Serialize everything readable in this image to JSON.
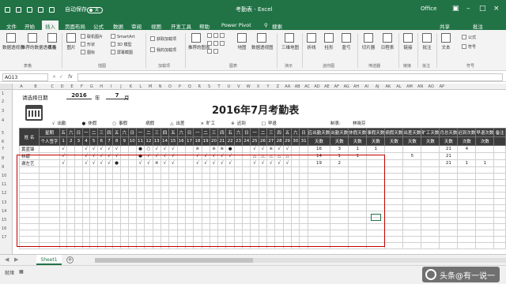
{
  "titlebar": {
    "autosave": "自动保存",
    "autosave_state": "关",
    "doc_title": "考勤表 - Excel",
    "account": "Office",
    "share": "共享",
    "comment": "批注"
  },
  "menu": {
    "tabs": [
      "文件",
      "开始",
      "插入",
      "页面布局",
      "公式",
      "数据",
      "审阅",
      "视图",
      "开发工具",
      "帮助",
      "Power Pivot",
      "搜索"
    ],
    "active": "插入"
  },
  "ribbon": {
    "btn": {
      "pivot": "数据透视表",
      "rec_pivot": "推荐的数据透视表",
      "table": "表格",
      "picture": "图片",
      "online_pic": "联机图片",
      "shapes": "形状",
      "icons": "图标",
      "smartart": "SmartArt",
      "model3d": "3D 模型",
      "screenshot": "屏幕截图",
      "get_addins": "获取加载项",
      "my_addins": "我的加载项",
      "rec_chart": "推荐的图表",
      "map": "地图",
      "pivot_chart": "数据透视图",
      "map3d": "三维地图",
      "line": "折线",
      "column": "柱形",
      "winloss": "盈亏",
      "slicer": "切片器",
      "timeline": "日程表",
      "link": "链接",
      "comment": "批注",
      "text": "文本",
      "formula": "公式",
      "symbol": "符号"
    },
    "groups": {
      "tables": "表格",
      "illustrations": "插图",
      "addins": "加载项",
      "charts": "图表",
      "tours": "演示",
      "sparklines": "迷你图",
      "filters": "筛选器",
      "links": "链接",
      "comments": "批注",
      "symbols": "符号"
    }
  },
  "formula": {
    "name_box": "AG13",
    "fx": "fx"
  },
  "columns": [
    "A",
    "B",
    "C",
    "D",
    "E",
    "F",
    "G",
    "H",
    "I",
    "J",
    "K",
    "L",
    "M",
    "N",
    "O",
    "P",
    "Q",
    "R",
    "S",
    "T",
    "U",
    "V",
    "W",
    "X",
    "Y",
    "Z",
    "AA",
    "AB",
    "AC",
    "AD",
    "AE",
    "AF",
    "AG",
    "AH",
    "AI",
    "AJ",
    "AK",
    "AL",
    "AM",
    "AN",
    "AO",
    "AP"
  ],
  "rows": [
    "1",
    "2",
    "3",
    "4",
    "5",
    "6",
    "7",
    "8",
    "9",
    "10",
    "11",
    "12",
    "13",
    "14",
    "15",
    "16",
    "17"
  ],
  "sheet": {
    "select_date": "请选择日期",
    "year": "2016",
    "year_unit": "年",
    "month": "7",
    "month_unit": "月",
    "title": "2016年7月考勤表",
    "legend": [
      {
        "s": "√",
        "l": "出勤"
      },
      {
        "s": "●",
        "l": "休假"
      },
      {
        "s": "○",
        "l": "事假"
      },
      {
        "s": "",
        "l": "病假"
      },
      {
        "s": "△",
        "l": "出差"
      },
      {
        "s": "×",
        "l": "旷工"
      },
      {
        "s": "※",
        "l": "迟到"
      },
      {
        "s": "□",
        "l": "早退"
      }
    ],
    "maker_label": "制表:",
    "maker": "林晓芬",
    "name_header": "姓 名",
    "week_label": "星期",
    "sign_label": "个人签字",
    "weekdays": [
      "五",
      "六",
      "日",
      "一",
      "二",
      "三",
      "四",
      "五",
      "六",
      "日",
      "一",
      "二",
      "三",
      "四",
      "五",
      "六",
      "日",
      "一",
      "二",
      "三",
      "四",
      "五",
      "六",
      "日",
      "一",
      "二",
      "三",
      "四",
      "五",
      "六",
      "日"
    ],
    "days": [
      "1",
      "2",
      "3",
      "4",
      "5",
      "6",
      "7",
      "8",
      "9",
      "10",
      "11",
      "12",
      "13",
      "14",
      "15",
      "16",
      "17",
      "18",
      "19",
      "20",
      "21",
      "22",
      "23",
      "24",
      "25",
      "26",
      "27",
      "28",
      "29",
      "30",
      "31"
    ],
    "summary_top": [
      "应出勤天数",
      "出勤天数",
      "休假天数",
      "事假天数",
      "病假天数",
      "出差天数",
      "旷工天数",
      "月总天数",
      "迟到次数",
      "早退次数",
      "备注"
    ],
    "summary_bottom": [
      "天数",
      "天数",
      "天数",
      "天数",
      "天数",
      "天数",
      "天数",
      "天数",
      "次数",
      "次数",
      ""
    ],
    "employees": [
      {
        "name": "黄蓝锋",
        "marks": [
          "√",
          "",
          "",
          "√",
          "√",
          "√",
          "√",
          "√",
          "",
          "",
          "●",
          "○",
          "√",
          "√",
          "√",
          "",
          "",
          "※",
          "",
          "※",
          "※",
          "●",
          "",
          "",
          "√",
          "√",
          "※",
          "√",
          "√",
          "",
          ""
        ],
        "stats": [
          "16",
          "3",
          "1",
          "1",
          "",
          "",
          "",
          "21",
          "4",
          "",
          ""
        ]
      },
      {
        "name": "林娜",
        "marks": [
          "√",
          "",
          "",
          "√",
          "√",
          "√",
          "√",
          "√",
          "",
          "",
          "●",
          "√",
          "√",
          "√",
          "√",
          "",
          "",
          "√",
          "√",
          "√",
          "√",
          "√",
          "",
          "",
          "△",
          "△",
          "△",
          "△",
          "△",
          "",
          ""
        ],
        "stats": [
          "14",
          "1",
          "1",
          "",
          "",
          "5",
          "",
          "21",
          "",
          "",
          ""
        ]
      },
      {
        "name": "谢左艺",
        "marks": [
          "√",
          "",
          "",
          "√",
          "√",
          "√",
          "√",
          "●",
          "",
          "",
          "√",
          "√",
          "※",
          "√",
          "√",
          "",
          "",
          "√",
          "√",
          "√",
          "√",
          "√",
          "",
          "",
          "√",
          "√",
          "√",
          "√",
          "√",
          "",
          ""
        ],
        "stats": [
          "19",
          "2",
          "",
          "",
          "",
          "",
          "",
          "21",
          "1",
          "1",
          ""
        ]
      }
    ]
  },
  "tabs": {
    "sheet": "Sheet1",
    "add": "+"
  },
  "status": {
    "ready": "就绪"
  },
  "watermark": "头条@有一说一"
}
